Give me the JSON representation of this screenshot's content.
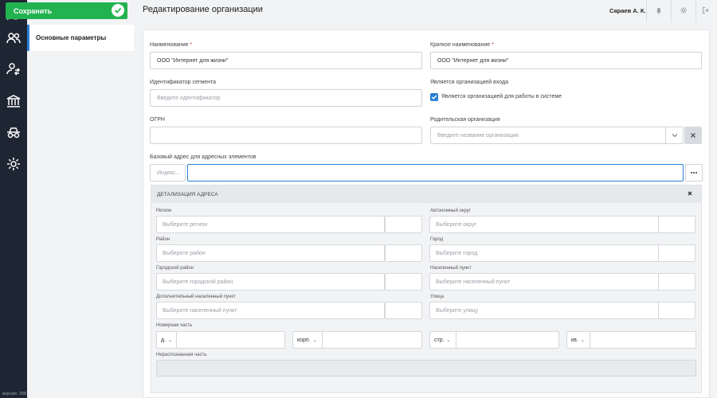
{
  "app": {
    "version_label": "версия: 208"
  },
  "toolbar": {
    "save_label": "Сохранить"
  },
  "nav": {
    "items": [
      {
        "label": "Основные параметры",
        "active": true
      }
    ]
  },
  "header": {
    "title": "Редактирование организации",
    "user_name": "Сараев А. К."
  },
  "form": {
    "name": {
      "label": "Наименование",
      "required_mark": "*",
      "value": "ООО \"Интернет для жизни\""
    },
    "short_name": {
      "label": "Краткое наименование",
      "required_mark": "*",
      "value": "ООО \"Интернет для жизни\""
    },
    "segment_id": {
      "label": "Идентификатор сегмента",
      "placeholder": "Введите идентификатор"
    },
    "is_entry_org": {
      "label": "Является организацией входа",
      "checkbox_label": "Является организацией для работы в системе",
      "checked": true
    },
    "ogrn": {
      "label": "ОГРН",
      "value": ""
    },
    "parent_org": {
      "label": "Родительская организация",
      "placeholder": "Введите название организации"
    },
    "base_address": {
      "label": "Базовый адрес для адресных элементов",
      "index_placeholder": "Индекс...",
      "value": ""
    }
  },
  "address_detail": {
    "title": "ДЕТАЛИЗАЦИЯ АДРЕСА",
    "region": {
      "label": "Регион",
      "placeholder": "Выберите регион"
    },
    "autonomous_okrug": {
      "label": "Автономный округ",
      "placeholder": "Выберите округ"
    },
    "district": {
      "label": "Район",
      "placeholder": "Выберите район"
    },
    "city": {
      "label": "Город",
      "placeholder": "Выберите город"
    },
    "city_district": {
      "label": "Городской район",
      "placeholder": "Выберите городской район"
    },
    "settlement": {
      "label": "Населенный пункт",
      "placeholder": "Выберите населенный пункт"
    },
    "extra_settlement": {
      "label": "Дополнительный населенный пункт",
      "placeholder": "Выберите населенный пункт"
    },
    "street": {
      "label": "Улица",
      "placeholder": "Выберите улицу"
    },
    "number_part": {
      "label": "Номерная часть",
      "house_type": "д.",
      "building_type": "корп.",
      "structure_type": "стр.",
      "apartment_type": "кв."
    },
    "unrecognized": {
      "label": "Нераспознанная часть"
    }
  },
  "icons": {
    "rail": [
      "logo-map-icon",
      "users-icon",
      "user-transfer-icon",
      "institution-icon",
      "incognito-icon",
      "settings-gear-icon"
    ],
    "header": [
      "bell-icon",
      "gear-icon",
      "logout-icon"
    ]
  },
  "colors": {
    "primary": "#2b7fd4",
    "success": "#22b350",
    "rail_bg": "#1f2633",
    "required": "#d9342b"
  }
}
